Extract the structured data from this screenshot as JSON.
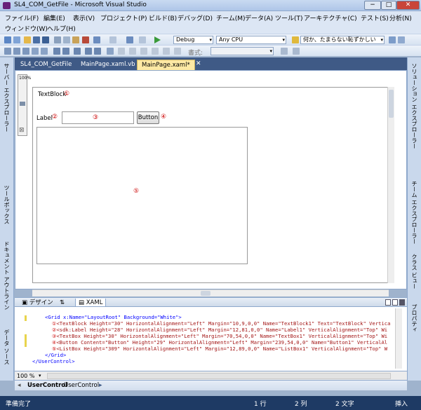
{
  "window": {
    "title": "SL4_COM_GetFile - Microsoft Visual Studio"
  },
  "window_buttons": {
    "minimize": "−",
    "maximize": "□",
    "close": "✕"
  },
  "menu": {
    "row1": [
      "ファイル(F)",
      "編集(E)",
      "表示(V)",
      "プロジェクト(P)",
      "ビルド(B)",
      "デバッグ(D)",
      "チーム(M)",
      "データ(A)",
      "ツール(T)",
      "アーキテクチャ(C)",
      "テスト(S)",
      "分析(N)"
    ],
    "row2": [
      "ウィンドウ(W)",
      "ヘルプ(H)"
    ]
  },
  "toolbar": {
    "config": "Debug",
    "platform": "Any CPU",
    "search": "何か、たまらない恥ずかしい",
    "format_label": "書式:"
  },
  "tabs": [
    "SL4_COM_GetFile",
    "MainPage.xaml.vb",
    "MainPage.xaml*"
  ],
  "active_tab": 2,
  "left_panels": [
    "サーバー エクスプローラー",
    "ツールボックス",
    "ドキュメント アウトライン",
    "データ ソース"
  ],
  "right_panels": [
    "ソリューション エクスプローラー",
    "チーム エクスプローラー",
    "クラス ビュー",
    "プロパティ"
  ],
  "designer": {
    "zoom": "100%",
    "textblock": "TextBlock",
    "label": "Label",
    "button": "Button",
    "n1": "①",
    "n2": "②",
    "n3": "③",
    "n4": "④",
    "n5": "⑤"
  },
  "splitter": {
    "design": "デザイン",
    "swap": "⇅",
    "xaml": "XAML"
  },
  "xaml_lines": [
    {
      "mark": "",
      "text": "<Grid x:Name=\"LayoutRoot\" Background=\"White\">"
    },
    {
      "mark": "①",
      "text": "<TextBlock Height=\"30\" HorizontalAlignment=\"Left\" Margin=\"10,9,0,0\" Name=\"TextBlock1\" Text=\"TextBlock\" Vertica"
    },
    {
      "mark": "②",
      "text": "<sdk:Label Height=\"28\" HorizontalAlignment=\"Left\" Margin=\"12,81,0,0\" Name=\"Label1\" VerticalAlignment=\"Top\" Wi"
    },
    {
      "mark": "③",
      "text": "<TextBox Height=\"30\" HorizontalAlignment=\"Left\" Margin=\"70,54,0,0\" Name=\"TextBox1\" VerticalAlignment=\"Top\" Wi"
    },
    {
      "mark": "④",
      "text": "<Button Content=\"Button\" Height=\"29\" HorizontalAlignment=\"Left\" Margin=\"239,54,0,0\" Name=\"Button1\" VerticalAl"
    },
    {
      "mark": "⑤",
      "text": "<ListBox Height=\"309\" HorizontalAlignment=\"Left\" Margin=\"12,89,0,0\" Name=\"ListBox1\" VerticalAlignment=\"Top\" W"
    },
    {
      "mark": "",
      "text": "</Grid>"
    },
    {
      "mark": "",
      "text": "</UserControl>"
    }
  ],
  "code_zoom": "100 %",
  "breadcrumb": {
    "item1": "UserControl",
    "item2": "UserControl"
  },
  "status": {
    "ready": "準備完了",
    "line": "1 行",
    "col": "2 列",
    "char": "2 文字",
    "mode": "挿入"
  }
}
